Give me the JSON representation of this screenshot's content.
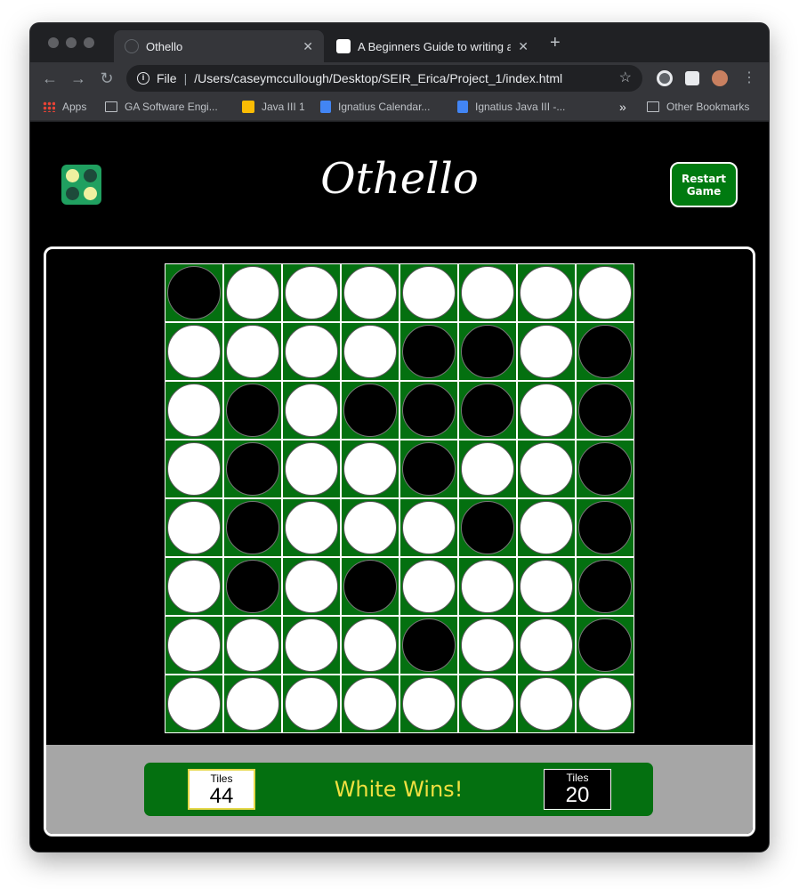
{
  "browser": {
    "tabs": [
      {
        "title": "Othello",
        "active": true,
        "favicon": "globe-icon"
      },
      {
        "title": "A Beginners Guide to writing a",
        "active": false,
        "favicon": "medium-icon"
      }
    ],
    "close_glyph": "✕",
    "new_tab_glyph": "+",
    "address": {
      "scheme": "File",
      "url": "/Users/caseymccullough/Desktop/SEIR_Erica/Project_1/index.html"
    },
    "bookmarks": [
      "Apps",
      "GA Software Engi...",
      "Java III 1",
      "Ignatius Calendar...",
      "Ignatius Java III -..."
    ],
    "other_bookmarks": "Other Bookmarks",
    "overflow_glyph": "»"
  },
  "game": {
    "title": "Othello",
    "restart_label": "Restart\nGame",
    "board": [
      [
        "b",
        "w",
        "w",
        "w",
        "w",
        "w",
        "w",
        "w"
      ],
      [
        "w",
        "w",
        "w",
        "w",
        "b",
        "b",
        "w",
        "b"
      ],
      [
        "w",
        "b",
        "w",
        "b",
        "b",
        "b",
        "w",
        "b"
      ],
      [
        "w",
        "b",
        "w",
        "w",
        "b",
        "w",
        "w",
        "b"
      ],
      [
        "w",
        "b",
        "w",
        "w",
        "w",
        "b",
        "w",
        "b"
      ],
      [
        "w",
        "b",
        "w",
        "b",
        "w",
        "w",
        "w",
        "b"
      ],
      [
        "w",
        "w",
        "w",
        "w",
        "b",
        "w",
        "w",
        "b"
      ],
      [
        "w",
        "w",
        "w",
        "w",
        "w",
        "w",
        "w",
        "w"
      ]
    ],
    "white": {
      "label": "Tiles",
      "count": "44"
    },
    "black": {
      "label": "Tiles",
      "count": "20"
    },
    "status": "White Wins!"
  },
  "colors": {
    "board_green": "#047010",
    "button_green": "#007a10",
    "status_yellow": "#f0e040",
    "score_bar_gray": "#a6a6a6"
  }
}
